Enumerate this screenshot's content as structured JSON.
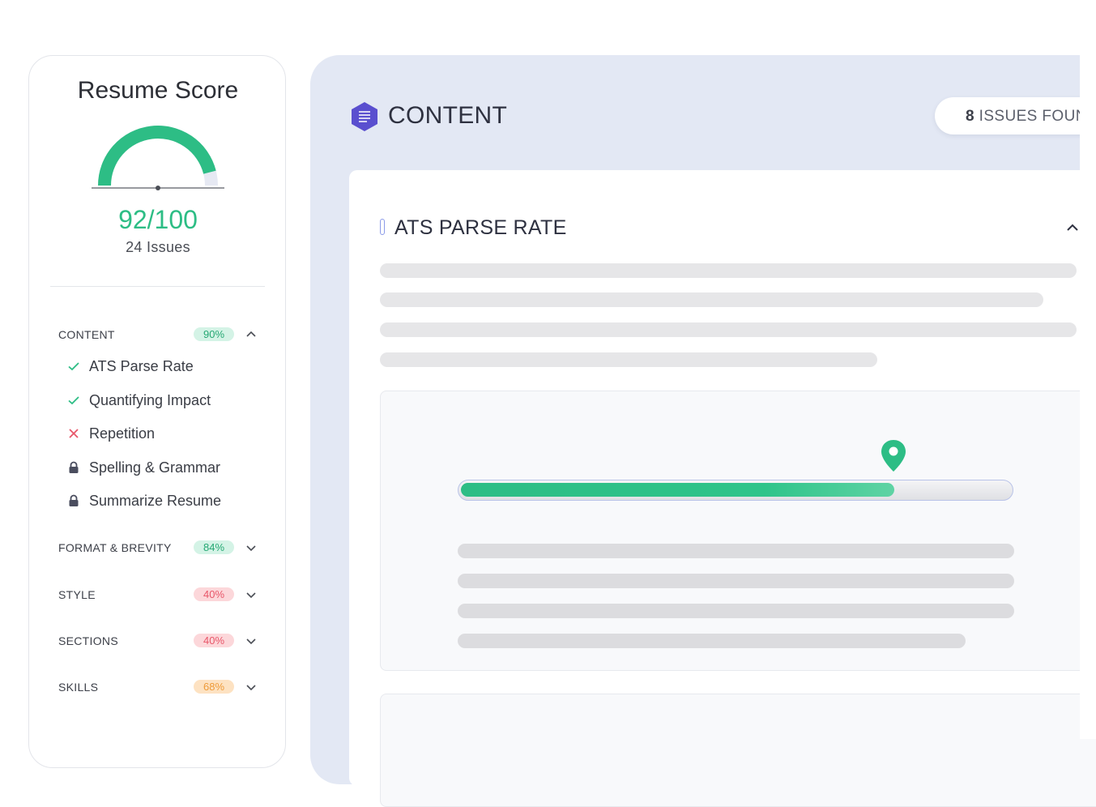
{
  "sidebar": {
    "title": "Resume Score",
    "score": "92/100",
    "score_fraction": 0.92,
    "issues": "24 Issues",
    "categories": [
      {
        "label": "CONTENT",
        "pct": "90%",
        "status": "green",
        "expanded": true,
        "items": [
          {
            "label": "ATS Parse Rate",
            "status": "check-icon"
          },
          {
            "label": "Quantifying Impact",
            "status": "check-icon"
          },
          {
            "label": "Repetition",
            "status": "cross-icon"
          },
          {
            "label": "Spelling & Grammar",
            "status": "lock-icon"
          },
          {
            "label": "Summarize Resume",
            "status": "lock-icon"
          }
        ]
      },
      {
        "label": "FORMAT & BREVITY",
        "pct": "84%",
        "status": "green",
        "expanded": false
      },
      {
        "label": "STYLE",
        "pct": "40%",
        "status": "red",
        "expanded": false
      },
      {
        "label": "SECTIONS",
        "pct": "40%",
        "status": "red",
        "expanded": false
      },
      {
        "label": "SKILLS",
        "pct": "68%",
        "status": "orange",
        "expanded": false
      }
    ]
  },
  "main": {
    "section_title": "CONTENT",
    "section_icon": "document-lines-icon",
    "issues_found_count": "8",
    "issues_found_text": " ISSUES FOUND",
    "metric_title": "ATS PARSE RATE",
    "progress_fraction": 0.79
  },
  "colors": {
    "accent_green": "#2dbd85",
    "accent_purple": "#5a4fcf",
    "panel_bg": "#e3e8f4"
  }
}
